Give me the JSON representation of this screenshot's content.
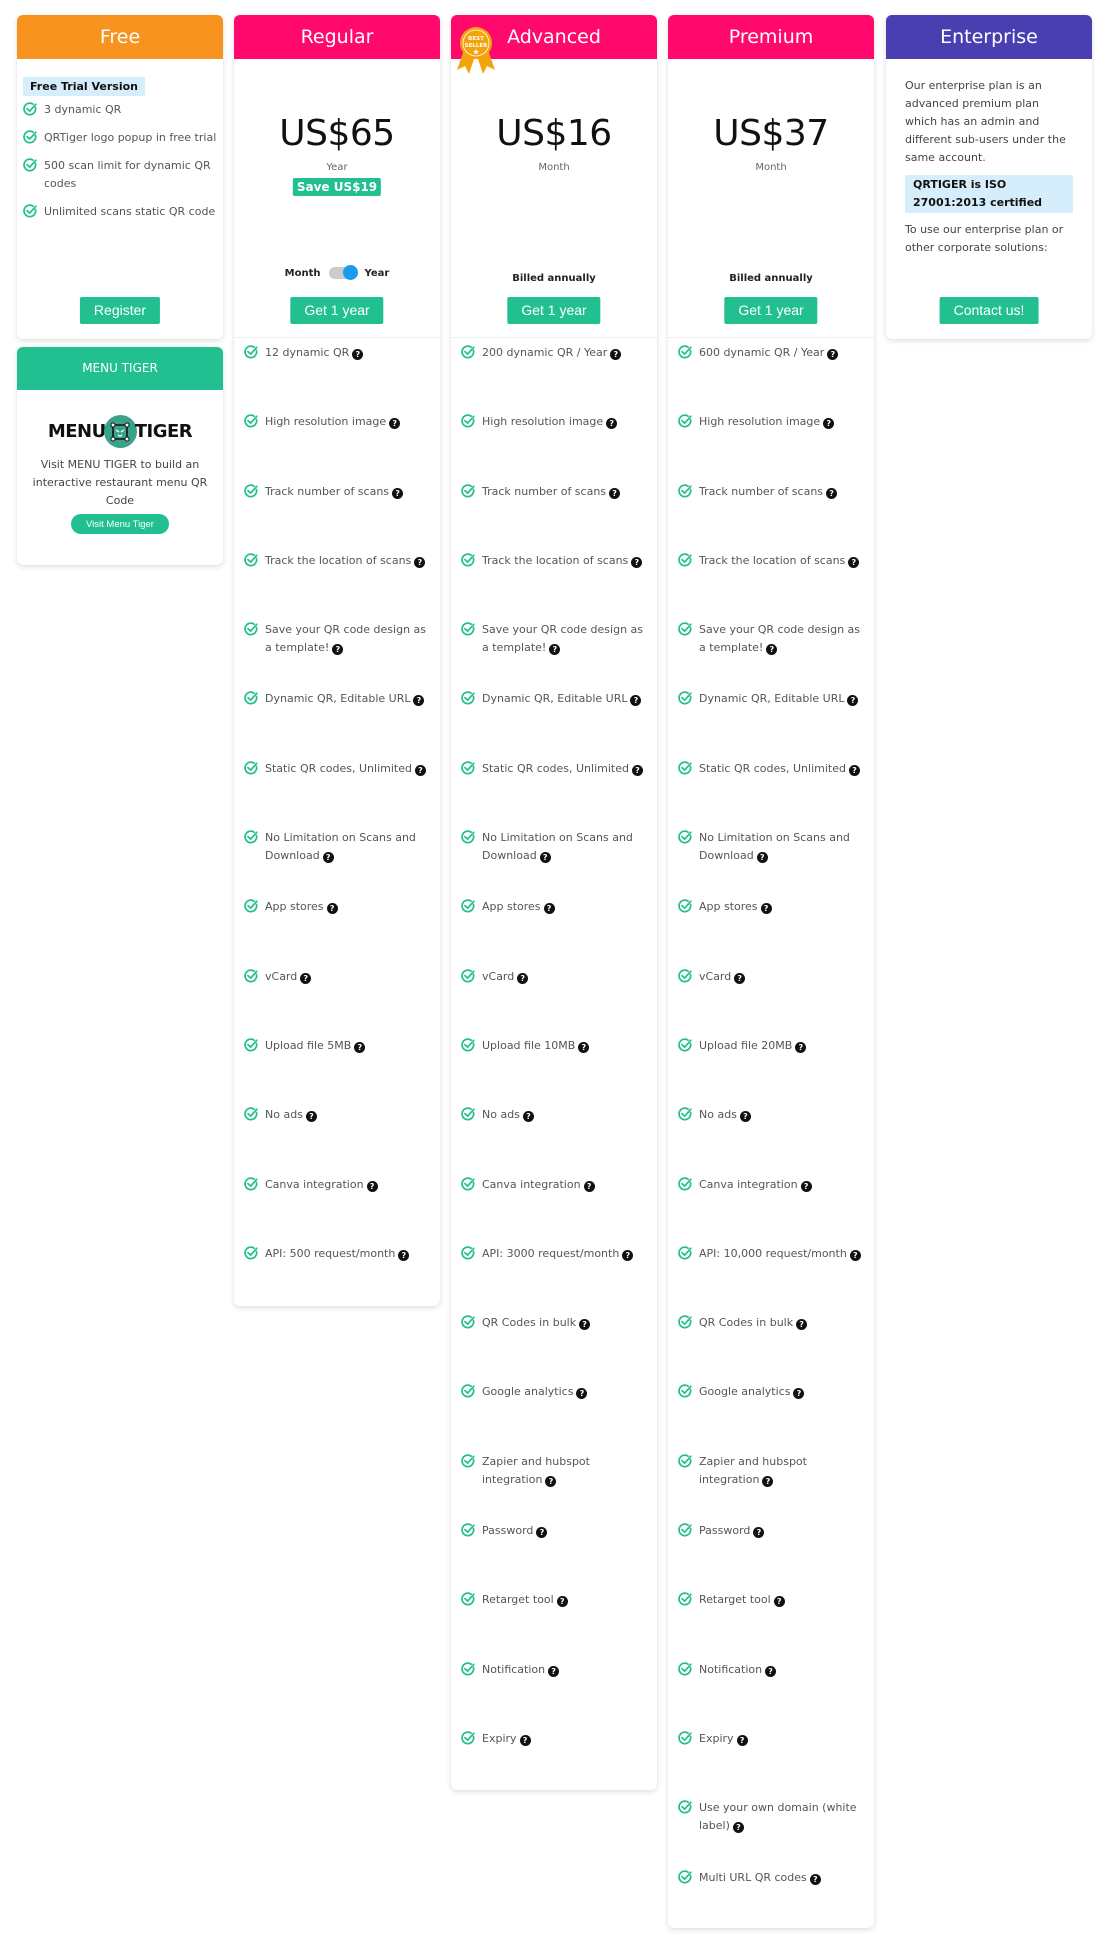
{
  "colors": {
    "free": "#f7931e",
    "regular": "#ff0a6c",
    "advanced": "#ff0a6c",
    "premium": "#ff0a6c",
    "enterprise": "#4a3fb0",
    "accent": "#22bf91"
  },
  "free": {
    "title": "Free",
    "badge": "Free Trial Version",
    "items": [
      "3 dynamic QR",
      "QRTiger logo popup in free trial",
      "500 scan limit for dynamic QR codes",
      "Unlimited scans static QR code"
    ],
    "button": "Register"
  },
  "menu_tiger": {
    "title": "MENU TIGER",
    "logo_left": "MENU",
    "logo_right": "TIGER",
    "text": "Visit MENU TIGER to build an interactive restaurant menu QR Code",
    "button": "Visit Menu Tiger"
  },
  "regular": {
    "title": "Regular",
    "price": "US$65",
    "period": "Year",
    "save": "Save US$19",
    "toggle": {
      "left": "Month",
      "right": "Year",
      "selected": "Year"
    },
    "button": "Get 1 year",
    "features": [
      "12 dynamic QR",
      "High resolution image",
      "Track number of scans",
      "Track the location of scans",
      "Save your QR code design as a template!",
      "Dynamic QR, Editable URL",
      "Static QR codes, Unlimited",
      "No Limitation on Scans and Download",
      "App stores",
      "vCard",
      "Upload file 5MB",
      "No ads",
      "Canva integration",
      "API: 500 request/month"
    ]
  },
  "advanced": {
    "title": "Advanced",
    "ribbon": {
      "line1": "BEST",
      "line2": "SELLER"
    },
    "price": "US$16",
    "period": "Month",
    "billed": "Billed annually",
    "button": "Get 1 year",
    "features": [
      "200 dynamic QR / Year",
      "High resolution image",
      "Track number of scans",
      "Track the location of scans",
      "Save your QR code design as a template!",
      "Dynamic QR, Editable URL",
      "Static QR codes, Unlimited",
      "No Limitation on Scans and Download",
      "App stores",
      "vCard",
      "Upload file 10MB",
      "No ads",
      "Canva integration",
      "API: 3000 request/month",
      "QR Codes in bulk",
      "Google analytics",
      "Zapier and hubspot integration",
      "Password",
      "Retarget tool",
      "Notification",
      "Expiry"
    ]
  },
  "premium": {
    "title": "Premium",
    "price": "US$37",
    "period": "Month",
    "billed": "Billed annually",
    "button": "Get 1 year",
    "features": [
      "600 dynamic QR / Year",
      "High resolution image",
      "Track number of scans",
      "Track the location of scans",
      "Save your QR code design as a template!",
      "Dynamic QR, Editable URL",
      "Static QR codes, Unlimited",
      "No Limitation on Scans and Download",
      "App stores",
      "vCard",
      "Upload file 20MB",
      "No ads",
      "Canva integration",
      "API: 10,000 request/month",
      "QR Codes in bulk",
      "Google analytics",
      "Zapier and hubspot integration",
      "Password",
      "Retarget tool",
      "Notification",
      "Expiry",
      "Use your own domain (white label)",
      "Multi URL QR codes"
    ]
  },
  "enterprise": {
    "title": "Enterprise",
    "description": "Our enterprise plan is an advanced premium plan which has an admin and different sub-users under the same account.",
    "iso": "QRTIGER is ISO 27001:2013 certified",
    "after": "To use our enterprise plan or other corporate solutions:",
    "button": "Contact us!"
  },
  "icons": {
    "feature": "check-circle-icon",
    "help": "question-circle-icon"
  },
  "help_glyph": "?"
}
